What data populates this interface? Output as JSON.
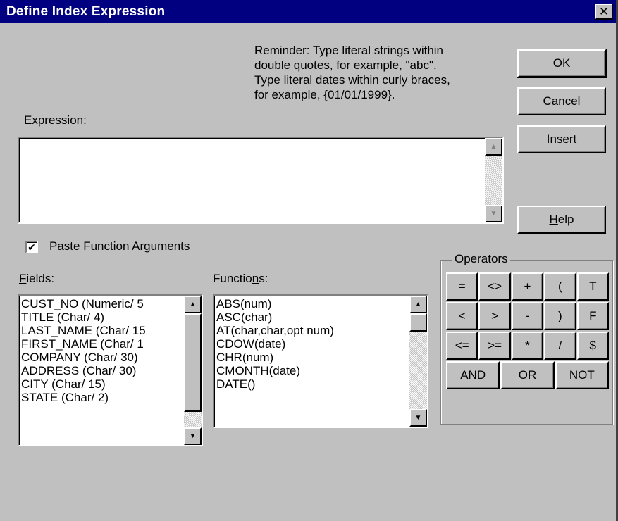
{
  "window": {
    "title": "Define Index Expression",
    "close_glyph": "✕"
  },
  "reminder": "Reminder: Type literal strings within\ndouble quotes, for example, \"abc\".\nType literal dates within curly braces,\nfor example, {01/01/1999}.",
  "buttons": {
    "ok": "OK",
    "cancel": "Cancel",
    "insert": "Insert",
    "help": "Help"
  },
  "expression": {
    "label": "Expression:",
    "value": ""
  },
  "paste_args": {
    "label": "Paste Function Arguments",
    "checked": true,
    "check_glyph": "✔"
  },
  "fields": {
    "label": "Fields:",
    "items": [
      "CUST_NO (Numeric/ 5",
      "TITLE (Char/ 4)",
      "LAST_NAME (Char/ 15",
      "FIRST_NAME (Char/ 1",
      "COMPANY (Char/ 30)",
      "ADDRESS (Char/ 30)",
      "CITY (Char/ 15)",
      "STATE (Char/ 2)"
    ]
  },
  "functions": {
    "label": "Functions:",
    "items": [
      "ABS(num)",
      "ASC(char)",
      "AT(char,char,opt num)",
      "CDOW(date)",
      "CHR(num)",
      "CMONTH(date)",
      "DATE()"
    ]
  },
  "operators": {
    "label": "Operators",
    "rows": [
      [
        "=",
        "<>",
        "+",
        "(",
        "T"
      ],
      [
        "<",
        ">",
        "-",
        ")",
        "F"
      ],
      [
        "<=",
        ">=",
        "*",
        "/",
        "$"
      ]
    ],
    "logical": [
      "AND",
      "OR",
      "NOT"
    ]
  },
  "scroll_glyphs": {
    "up": "▲",
    "down": "▼"
  }
}
